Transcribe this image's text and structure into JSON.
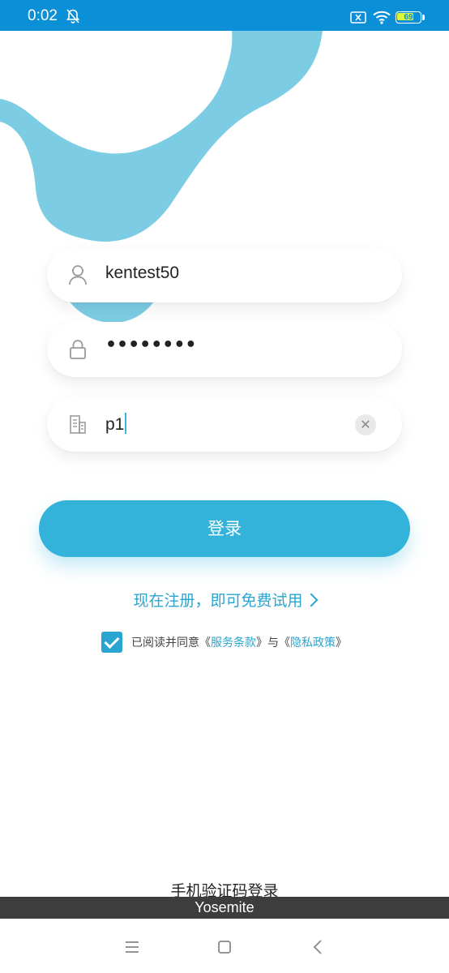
{
  "status_bar": {
    "time": "0:02",
    "battery": "69",
    "bg_color": "#0b8fd6"
  },
  "form": {
    "username": "kentest50",
    "password_masked": "••••••••",
    "company": "p1"
  },
  "login_button": "登录",
  "register_link": "现在注册，即可免费试用",
  "agreement": {
    "prefix": "已阅读并同意《",
    "terms": "服务条款",
    "mid": "》与《",
    "privacy": "隐私政策",
    "suffix": "》",
    "checked": true
  },
  "sms_login": "手机验证码登录",
  "caption": "Yosemite",
  "colors": {
    "accent": "#2aa5cf",
    "button": "#33b2da",
    "blob": "#7ccde4"
  }
}
